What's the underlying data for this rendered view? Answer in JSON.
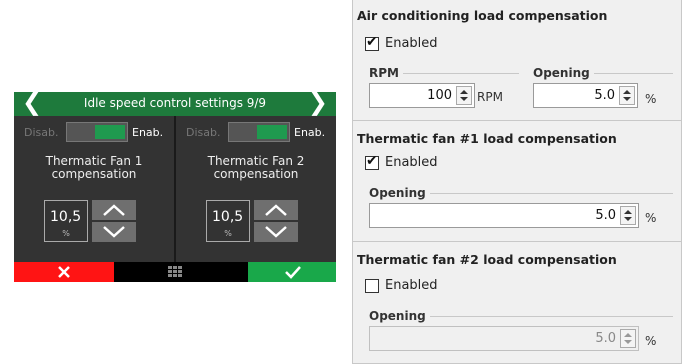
{
  "ecu": {
    "header_title": "Idle speed control settings 9/9",
    "nav_prev": "❮",
    "nav_next": "❯",
    "panels": [
      {
        "disab": "Disab.",
        "enab": "Enab.",
        "name": "Thermatic Fan 1\ncompensation",
        "value": "10,5",
        "unit": "%"
      },
      {
        "disab": "Disab.",
        "enab": "Enab.",
        "name": "Thermatic Fan 2\ncompensation",
        "value": "10,5",
        "unit": "%"
      }
    ],
    "colors": {
      "header": "#1e7a3c",
      "cancel": "#ff1414",
      "ok": "#19a84a"
    }
  },
  "settings": {
    "ac": {
      "title": "Air conditioning load compensation",
      "enabled_label": "Enabled",
      "enabled": true,
      "rpm_label": "RPM",
      "rpm_value": "100",
      "rpm_unit": "RPM",
      "opening_label": "Opening",
      "opening_value": "5.0",
      "opening_unit": "%"
    },
    "fan1": {
      "title": "Thermatic fan #1 load compensation",
      "enabled_label": "Enabled",
      "enabled": true,
      "opening_label": "Opening",
      "opening_value": "5.0",
      "opening_unit": "%"
    },
    "fan2": {
      "title": "Thermatic fan #2 load compensation",
      "enabled_label": "Enabled",
      "enabled": false,
      "opening_label": "Opening",
      "opening_value": "5.0",
      "opening_unit": "%"
    }
  }
}
